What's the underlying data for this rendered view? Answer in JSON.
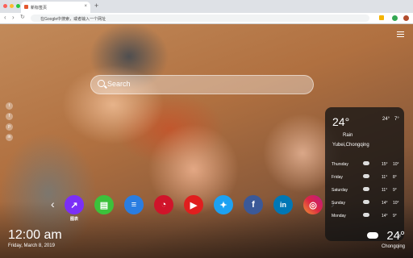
{
  "browser": {
    "tab_title": "新标签页",
    "tab_close": "×",
    "new_tab": "+",
    "back": "‹",
    "forward": "›",
    "reload": "↻",
    "address_placeholder": "在Google中搜索，或者输入一个网址"
  },
  "search": {
    "placeholder": "Search"
  },
  "social_left": [
    "t",
    "f",
    "p",
    "in"
  ],
  "apps": [
    {
      "name": "chart",
      "label": "图表",
      "color": "#7b2ff7",
      "glyph": "↗"
    },
    {
      "name": "sheet",
      "label": "",
      "color": "#3cc13b",
      "glyph": "▤"
    },
    {
      "name": "docs",
      "label": "",
      "color": "#2a7de1",
      "glyph": "≡"
    },
    {
      "name": "red-app",
      "label": "",
      "color": "#d0142a",
      "glyph": "◔"
    },
    {
      "name": "youtube",
      "label": "",
      "color": "#e01e1e",
      "glyph": "▶"
    },
    {
      "name": "twitter",
      "label": "",
      "color": "#1da1f2",
      "glyph": "✦"
    },
    {
      "name": "facebook",
      "label": "",
      "color": "#3b5998",
      "glyph": "f"
    },
    {
      "name": "linkedin",
      "label": "",
      "color": "#0077b5",
      "glyph": "in"
    },
    {
      "name": "instagram",
      "label": "",
      "color": "#d6249f",
      "glyph": "◎"
    }
  ],
  "nav_arrows": {
    "left": "‹",
    "right": "›"
  },
  "clock": {
    "time": "12:00 am",
    "date": "Friday, March 8, 2019"
  },
  "weather_card": {
    "temp": "24°",
    "hi": "24°",
    "lo": "7°",
    "condition": "Rain",
    "location": "Yubei,Chongqing",
    "forecast": [
      {
        "day": "Thursday",
        "hi": "15°",
        "lo": "10°"
      },
      {
        "day": "Friday",
        "hi": "11°",
        "lo": "8°"
      },
      {
        "day": "Saturday",
        "hi": "11°",
        "lo": "9°"
      },
      {
        "day": "Sunday",
        "hi": "14°",
        "lo": "10°"
      },
      {
        "day": "Monday",
        "hi": "14°",
        "lo": "9°"
      }
    ],
    "close": "✕"
  },
  "weather_corner": {
    "temp": "24°",
    "city": "Chongqing"
  },
  "colors": {
    "card_bg": "#141414",
    "text": "#ffffff"
  }
}
